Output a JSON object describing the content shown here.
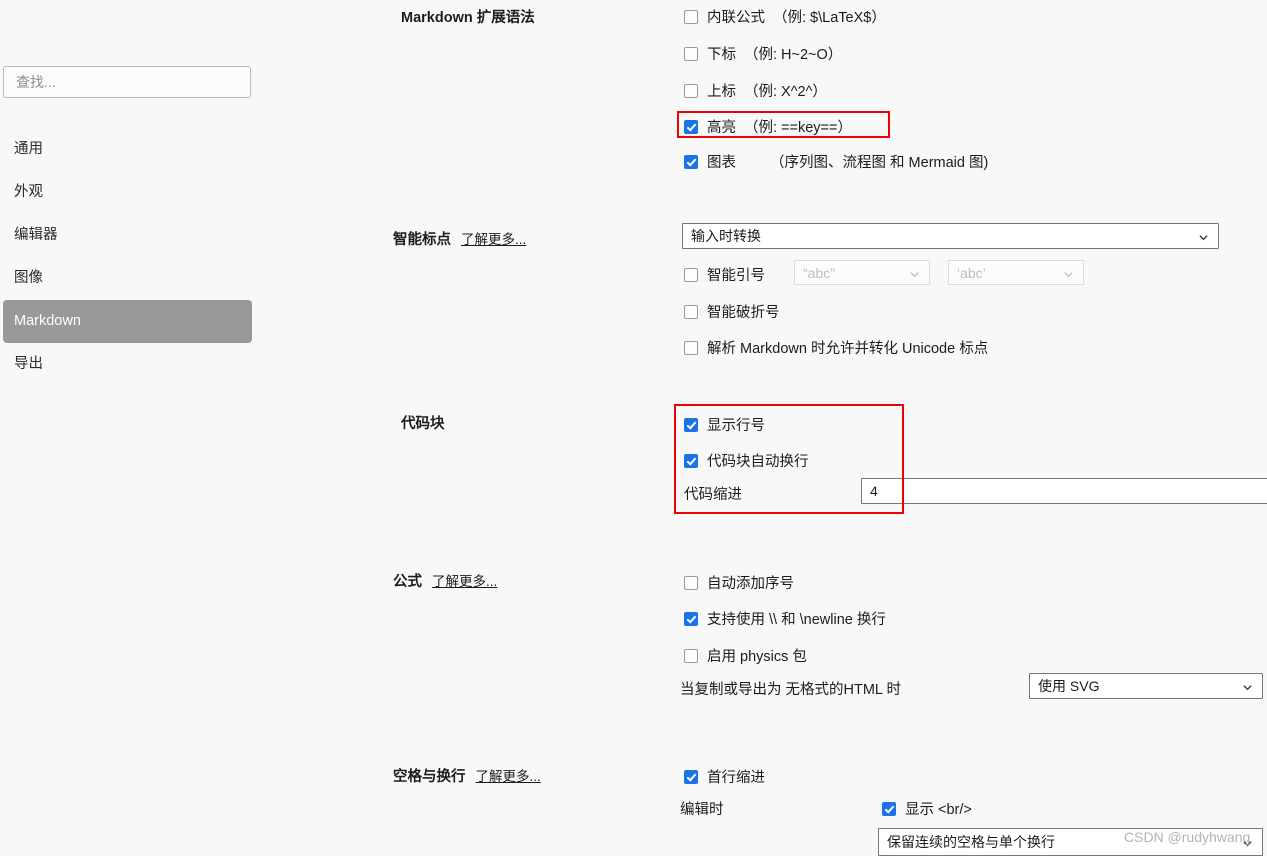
{
  "sidebar": {
    "search": {
      "placeholder": "查找..."
    },
    "items": [
      {
        "label": "通用",
        "selected": false
      },
      {
        "label": "外观",
        "selected": false
      },
      {
        "label": "编辑器",
        "selected": false
      },
      {
        "label": "图像",
        "selected": false
      },
      {
        "label": "Markdown",
        "selected": true
      },
      {
        "label": "导出",
        "selected": false
      }
    ]
  },
  "sections": {
    "markdown_ext": {
      "title": "Markdown 扩展语法",
      "options": [
        {
          "label": "内联公式",
          "hint": "（例: $\\LaTeX$）",
          "checked": false
        },
        {
          "label": "下标",
          "hint": "（例: H~2~O）",
          "checked": false
        },
        {
          "label": "上标",
          "hint": "（例: X^2^）",
          "checked": false
        },
        {
          "label": "高亮",
          "hint": "（例: ==key==）",
          "checked": true
        },
        {
          "label": "图表",
          "hint": "（序列图、流程图 和 Mermaid 图)",
          "checked": true
        }
      ]
    },
    "smart_punct": {
      "title": "智能标点",
      "learn_more": "了解更多...",
      "mode_select": "输入时转换",
      "smart_quotes": {
        "label": "智能引号",
        "checked": false
      },
      "double_quote_select": "“abc”",
      "single_quote_select": "‘abc’",
      "smart_dash": {
        "label": "智能破折号",
        "checked": false
      },
      "unicode_punct": {
        "label": "解析 Markdown 时允许并转化 Unicode 标点",
        "checked": false
      }
    },
    "code_block": {
      "title": "代码块",
      "show_line_numbers": {
        "label": "显示行号",
        "checked": true
      },
      "wrap_lines": {
        "label": "代码块自动换行",
        "checked": true
      },
      "indent_label": "代码缩进",
      "indent_value": "4"
    },
    "formula": {
      "title": "公式",
      "learn_more": "了解更多...",
      "auto_number": {
        "label": "自动添加序号",
        "checked": false
      },
      "newline_support": {
        "label": "支持使用 \\\\ 和 \\newline 换行",
        "checked": true
      },
      "physics_pkg": {
        "label": "启用 physics 包",
        "checked": false
      },
      "copy_export_label": "当复制或导出为 无格式的HTML 时",
      "copy_export_select": "使用 SVG"
    },
    "whitespace": {
      "title": "空格与换行",
      "learn_more": "了解更多...",
      "first_line_indent": {
        "label": "首行缩进",
        "checked": true
      },
      "editing_label": "编辑时",
      "show_br": {
        "label": "显示 <br/>",
        "checked": true
      },
      "preserve_select": "保留连续的空格与单个换行"
    }
  },
  "watermark": {
    "text": "CSDN @rudyhwang"
  },
  "colors": {
    "accent_checkbox": "#1a73e8",
    "highlight_border": "#ee0000",
    "selected_nav_bg": "#999999",
    "page_bg": "#f8f8f8"
  }
}
